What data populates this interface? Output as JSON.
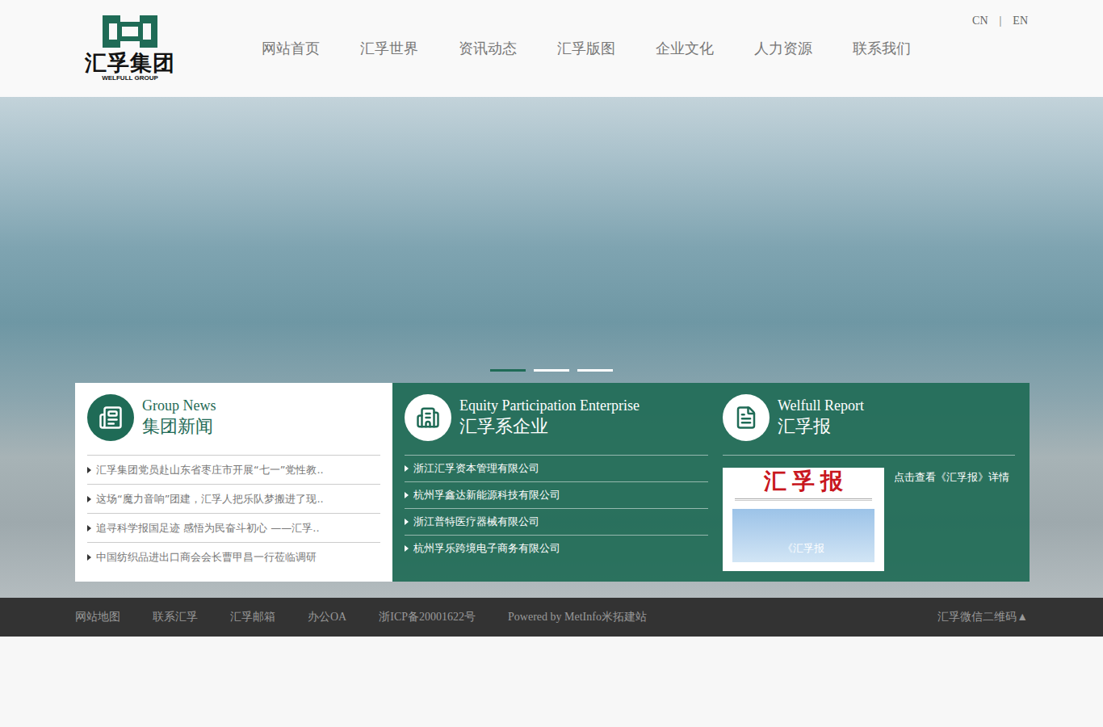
{
  "logo": {
    "name": "汇孚集团",
    "english": "WELFULL GROUP"
  },
  "nav": [
    {
      "label": "网站首页"
    },
    {
      "label": "汇孚世界"
    },
    {
      "label": "资讯动态"
    },
    {
      "label": "汇孚版图"
    },
    {
      "label": "企业文化"
    },
    {
      "label": "人力资源"
    },
    {
      "label": "联系我们"
    }
  ],
  "languages": {
    "items": [
      "CN",
      "EN"
    ],
    "separator": "|"
  },
  "slider": {
    "dots": [
      {
        "selected": true
      },
      {
        "selected": false
      },
      {
        "selected": false
      }
    ]
  },
  "news": {
    "title_en": "Group News",
    "title_cn": "集团新闻",
    "items": [
      "汇孚集团党员赴山东省枣庄市开展“七一”党性教..",
      "这场“魔力音响”团建，汇孚人把乐队梦搬进了现..",
      "追寻科学报国足迹 感悟为民奋斗初心 ——汇孚..",
      "中国纺织品进出口商会会长曹甲昌一行莅临调研"
    ]
  },
  "enterprises": {
    "title_en": "Equity Participation Enterprise",
    "title_cn": "汇孚系企业",
    "items": [
      "浙江汇孚资本管理有限公司",
      "杭州孚鑫达新能源科技有限公司",
      "浙江普特医疗器械有限公司",
      "杭州孚乐跨境电子商务有限公司"
    ]
  },
  "report": {
    "title_en": "Welfull Report",
    "title_cn": "汇孚报",
    "link": "点击查看《汇孚报》详情",
    "cover": {
      "masthead": "汇 孚 报",
      "caption": "《汇孚报"
    }
  },
  "footer": {
    "links": [
      "网站地图",
      "联系汇孚",
      "汇孚邮箱",
      "办公OA",
      "浙ICP备20001622号",
      "Powered by MetInfo米拓建站"
    ],
    "qr": "汇孚微信二维码▲"
  }
}
